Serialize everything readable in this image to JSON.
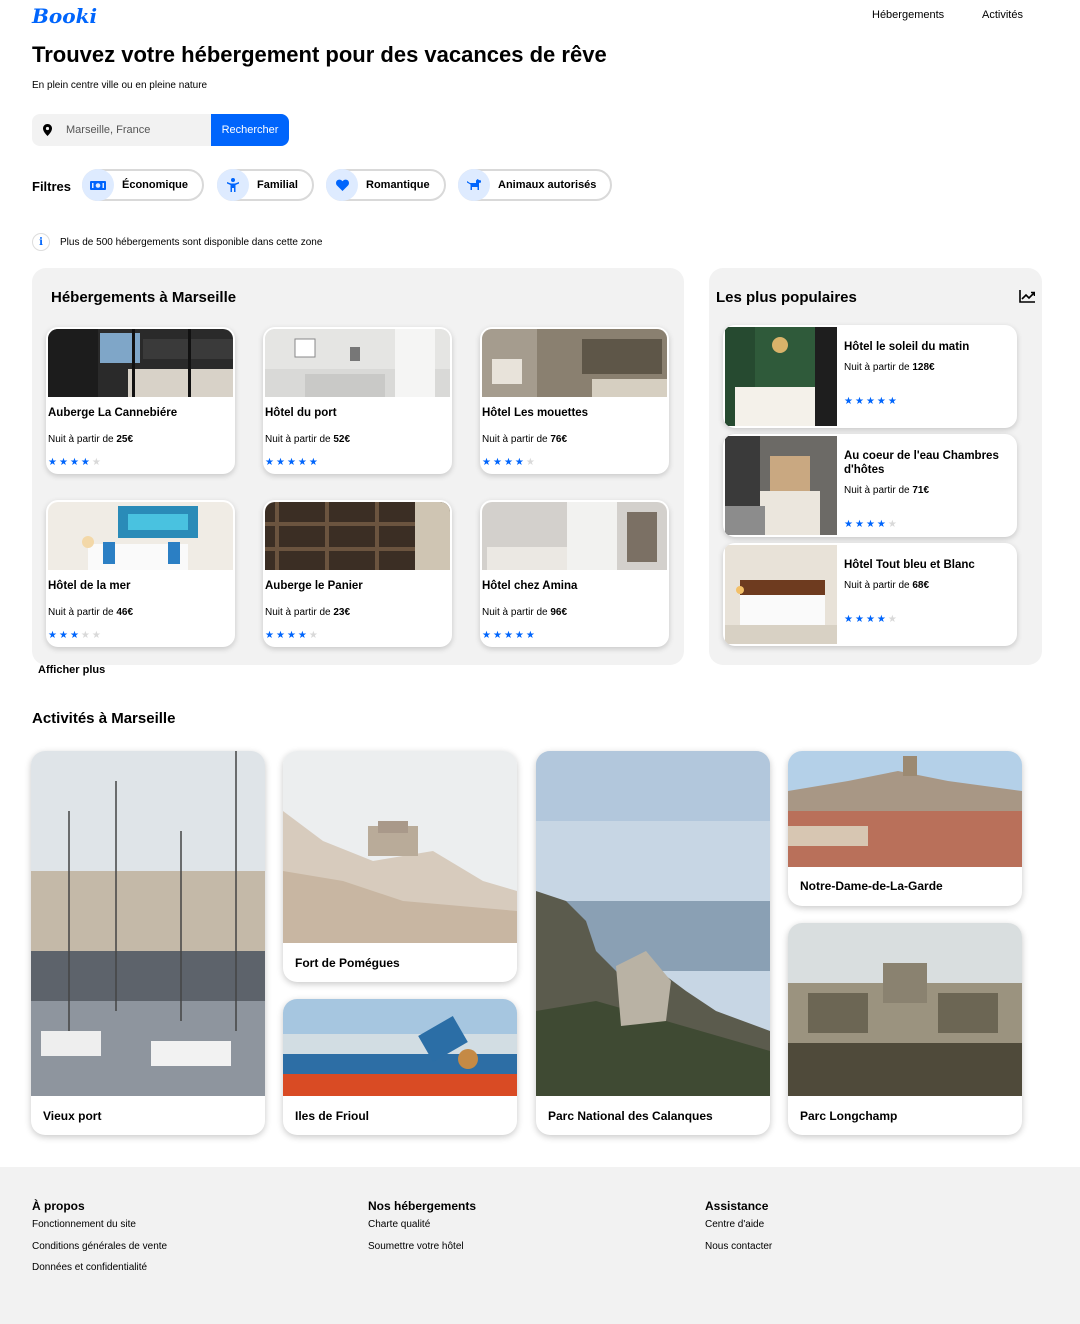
{
  "header": {
    "logo": "Booki",
    "nav": [
      "Hébergements",
      "Activités"
    ]
  },
  "hero": {
    "title": "Trouvez votre hébergement pour des vacances de rêve",
    "subtitle": "En plein centre ville ou en pleine nature"
  },
  "search": {
    "icon": "location-pin-icon",
    "value": "",
    "placeholder": "Marseille, France",
    "button": "Rechercher"
  },
  "filters": {
    "label": "Filtres",
    "items": [
      {
        "label": "Économique",
        "icon": "money-icon"
      },
      {
        "label": "Familial",
        "icon": "child-icon"
      },
      {
        "label": "Romantique",
        "icon": "heart-icon"
      },
      {
        "label": "Animaux autorisés",
        "icon": "dog-icon"
      }
    ]
  },
  "info": {
    "icon": "info-icon",
    "text": "Plus de 500 hébergements sont disponible dans cette zone"
  },
  "hebergements": {
    "title": "Hébergements à Marseille",
    "price_prefix": "Nuit à partir de",
    "items": [
      {
        "name": "Auberge La Cannebiére",
        "price": "25€",
        "rating": 4
      },
      {
        "name": "Hôtel du port",
        "price": "52€",
        "rating": 5
      },
      {
        "name": "Hôtel Les mouettes",
        "price": "76€",
        "rating": 4
      },
      {
        "name": "Hôtel de la mer",
        "price": "46€",
        "rating": 3
      },
      {
        "name": "Auberge le Panier",
        "price": "23€",
        "rating": 4
      },
      {
        "name": "Hôtel chez Amina",
        "price": "96€",
        "rating": 5
      }
    ],
    "more": "Afficher plus"
  },
  "populaires": {
    "title": "Les plus populaires",
    "icon": "trending-chart-icon",
    "price_prefix": "Nuit à partir de",
    "items": [
      {
        "name": "Hôtel le soleil du matin",
        "price": "128€",
        "rating": 5
      },
      {
        "name": "Au coeur de l'eau Chambres d'hôtes",
        "price": "71€",
        "rating": 4
      },
      {
        "name": "Hôtel Tout bleu et Blanc",
        "price": "68€",
        "rating": 4
      }
    ]
  },
  "activites": {
    "title": "Activités à Marseille",
    "items": [
      {
        "name": "Vieux port"
      },
      {
        "name": "Fort de Pomégues"
      },
      {
        "name": "Iles de Frioul"
      },
      {
        "name": "Parc National des Calanques"
      },
      {
        "name": "Notre-Dame-de-La-Garde"
      },
      {
        "name": "Parc Longchamp"
      }
    ]
  },
  "footer": {
    "columns": [
      {
        "title": "À propos",
        "links": [
          "Fonctionnement du site",
          "Conditions générales de vente",
          "Données et confidentialité"
        ]
      },
      {
        "title": "Nos hébergements",
        "links": [
          "Charte qualité",
          "Soumettre votre hôtel"
        ]
      },
      {
        "title": "Assistance",
        "links": [
          "Centre d'aide",
          "Nous contacter"
        ]
      }
    ]
  },
  "colors": {
    "accent": "#0065FC",
    "accent_light": "#DEEBFF",
    "panel": "#F2F2F2",
    "star_off": "#D9D9D9"
  }
}
